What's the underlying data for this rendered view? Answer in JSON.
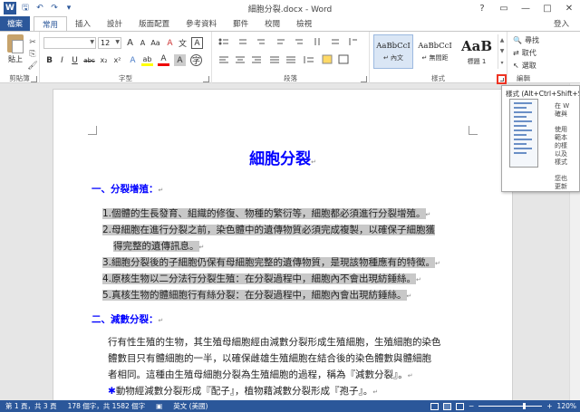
{
  "window": {
    "title": "細胞分裂.docx - Word",
    "controls": [
      "?",
      "▭",
      "—",
      "□",
      "✕"
    ]
  },
  "qat": {
    "app_icon": "W",
    "save": "🖫",
    "undo": "↶",
    "redo": "↷",
    "customize": "▾"
  },
  "tabs": {
    "file": "檔案",
    "items": [
      "常用",
      "插入",
      "設計",
      "版面配置",
      "參考資料",
      "郵件",
      "校閱",
      "檢視"
    ],
    "active_index": 0,
    "signin": "登入"
  },
  "ribbon": {
    "clipboard": {
      "label": "剪貼簿",
      "paste": "貼上",
      "cut": "✂",
      "copy": "⎘",
      "format_painter": "🖌"
    },
    "font": {
      "label": "字型",
      "font_name": "",
      "font_size": "12",
      "grow": "A",
      "shrink": "A",
      "case": "Aa",
      "clear": "A",
      "phonetic": "文",
      "border": "A",
      "bold": "B",
      "italic": "I",
      "underline": "U",
      "strike": "abc",
      "subscript": "x₂",
      "superscript": "x²",
      "effects": "A",
      "highlight": "ab",
      "color": "A",
      "shade": "A",
      "circle": "字"
    },
    "paragraph": {
      "label": "段落"
    },
    "styles": {
      "label": "樣式",
      "items": [
        {
          "sample": "AaBbCcI",
          "name": "↵ 內文",
          "selected": true
        },
        {
          "sample": "AaBbCcI",
          "name": "↵ 無間距",
          "selected": false
        },
        {
          "sample": "AaB",
          "name": "標題 1",
          "selected": false
        }
      ]
    },
    "editing": {
      "label": "編輯",
      "find": "尋找",
      "replace": "取代",
      "select": "選取"
    }
  },
  "tooltip": {
    "title": "樣式 (Alt+Ctrl+Shift+S)",
    "lines_a": [
      "在 W",
      "確與"
    ],
    "lines_b": [
      "使用",
      "範本",
      "的樣",
      "以及",
      "樣式"
    ],
    "lines_c": [
      "您也",
      "更新"
    ]
  },
  "document": {
    "title": "細胞分裂",
    "heading1": "一、分裂增殖：",
    "list": [
      "1.個體的生長發育、組織的修復、物種的繁衍等，細胞都必須進行分裂增殖。",
      "2.母細胞在進行分裂之前，染色體中的遺傳物質必須完成複製，以確保子細胞獲",
      "得完整的遺傳訊息。",
      "3.細胞分裂後的子細胞仍保有母細胞完整的遺傳物質，是現該物種應有的特徵。",
      "4.原核生物以二分法行分裂生殖：在分裂過程中，細胞內不會出現紡錘絲。",
      "5.真核生物的體細胞行有絲分裂：在分裂過程中，細胞內會出現紡錘絲。"
    ],
    "heading2": "二、減數分裂：",
    "para": [
      "行有性生殖的生物，其生殖母細胞經由減數分裂形成生殖細胞，生殖細胞的染色",
      "體數目只有體細胞的一半，以確保雌雄生殖細胞在結合後的染色體數與體細胞",
      "者相同。這種由生殖母細胞分裂為生殖細胞的過程，稱為『減數分裂』。",
      "動物經減數分裂形成『配子』，植物藉減數分裂形成『孢子』。"
    ],
    "para_mark": "↵",
    "bullet": "✱"
  },
  "status": {
    "page": "第 1 頁，共 3 頁",
    "words": "178 個字，共 1582 個字",
    "lang": "英文 (美國)",
    "zoom_minus": "−",
    "zoom_plus": "+",
    "zoom": "120%",
    "zoom_fraction": 0.7
  },
  "colors": {
    "accent": "#2b579a",
    "heading": "#0000ff",
    "highlight": "#c8c8c8",
    "launcher_highlight": "#e32222"
  }
}
